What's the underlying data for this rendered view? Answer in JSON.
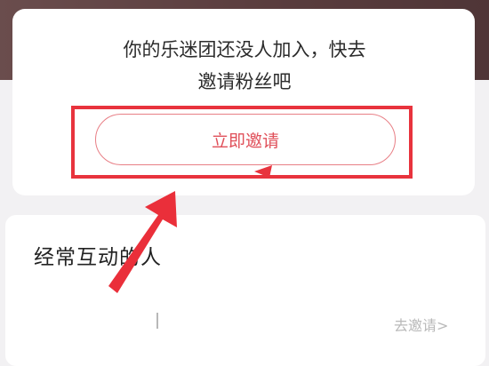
{
  "invite_card": {
    "message_line1": "你的乐迷团还没人加入，快去",
    "message_line2": "邀请粉丝吧",
    "button_label": "立即邀请"
  },
  "interactions_section": {
    "title": "经常互动的人",
    "go_invite_label": "去邀请>"
  },
  "colors": {
    "highlight_red": "#e8333d",
    "button_text": "#e0505a",
    "banner": "#5a3d3e"
  }
}
